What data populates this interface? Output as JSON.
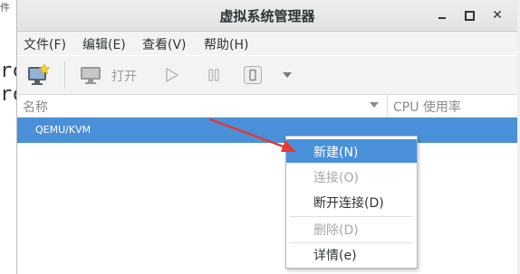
{
  "background": {
    "top_text": "件",
    "terminal_lines": [
      "rc",
      "rc"
    ]
  },
  "window": {
    "title": "虚拟系统管理器",
    "controls": [
      "minimize-icon",
      "maximize-icon",
      "close-icon"
    ]
  },
  "menubar": {
    "items": [
      {
        "label": "文件(F)"
      },
      {
        "label": "编辑(E)"
      },
      {
        "label": "查看(V)"
      },
      {
        "label": "帮助(H)"
      }
    ]
  },
  "toolbar": {
    "new_icon": "new-vm-icon",
    "open_icon": "monitor-icon",
    "open_label": "打开",
    "run_icon": "play-icon",
    "pause_icon": "pause-icon",
    "shutdown_icon": "shutdown-icon",
    "dropdown_icon": "chevron-down-icon"
  },
  "list": {
    "columns": [
      {
        "label": "名称"
      },
      {
        "label": "CPU 使用率"
      }
    ],
    "rows": [
      {
        "name": "QEMU/KVM",
        "selected": true
      }
    ]
  },
  "context_menu": {
    "items": [
      {
        "label": "新建(N)",
        "state": "highlighted"
      },
      {
        "label": "连接(O)",
        "state": "disabled"
      },
      {
        "label": "断开连接(D)",
        "state": "enabled"
      },
      {
        "label": "删除(D)",
        "state": "disabled"
      },
      {
        "label": "详情(e)",
        "state": "enabled"
      }
    ]
  },
  "colors": {
    "accent": "#4a90d9",
    "annotation_arrow": "#e53935"
  }
}
